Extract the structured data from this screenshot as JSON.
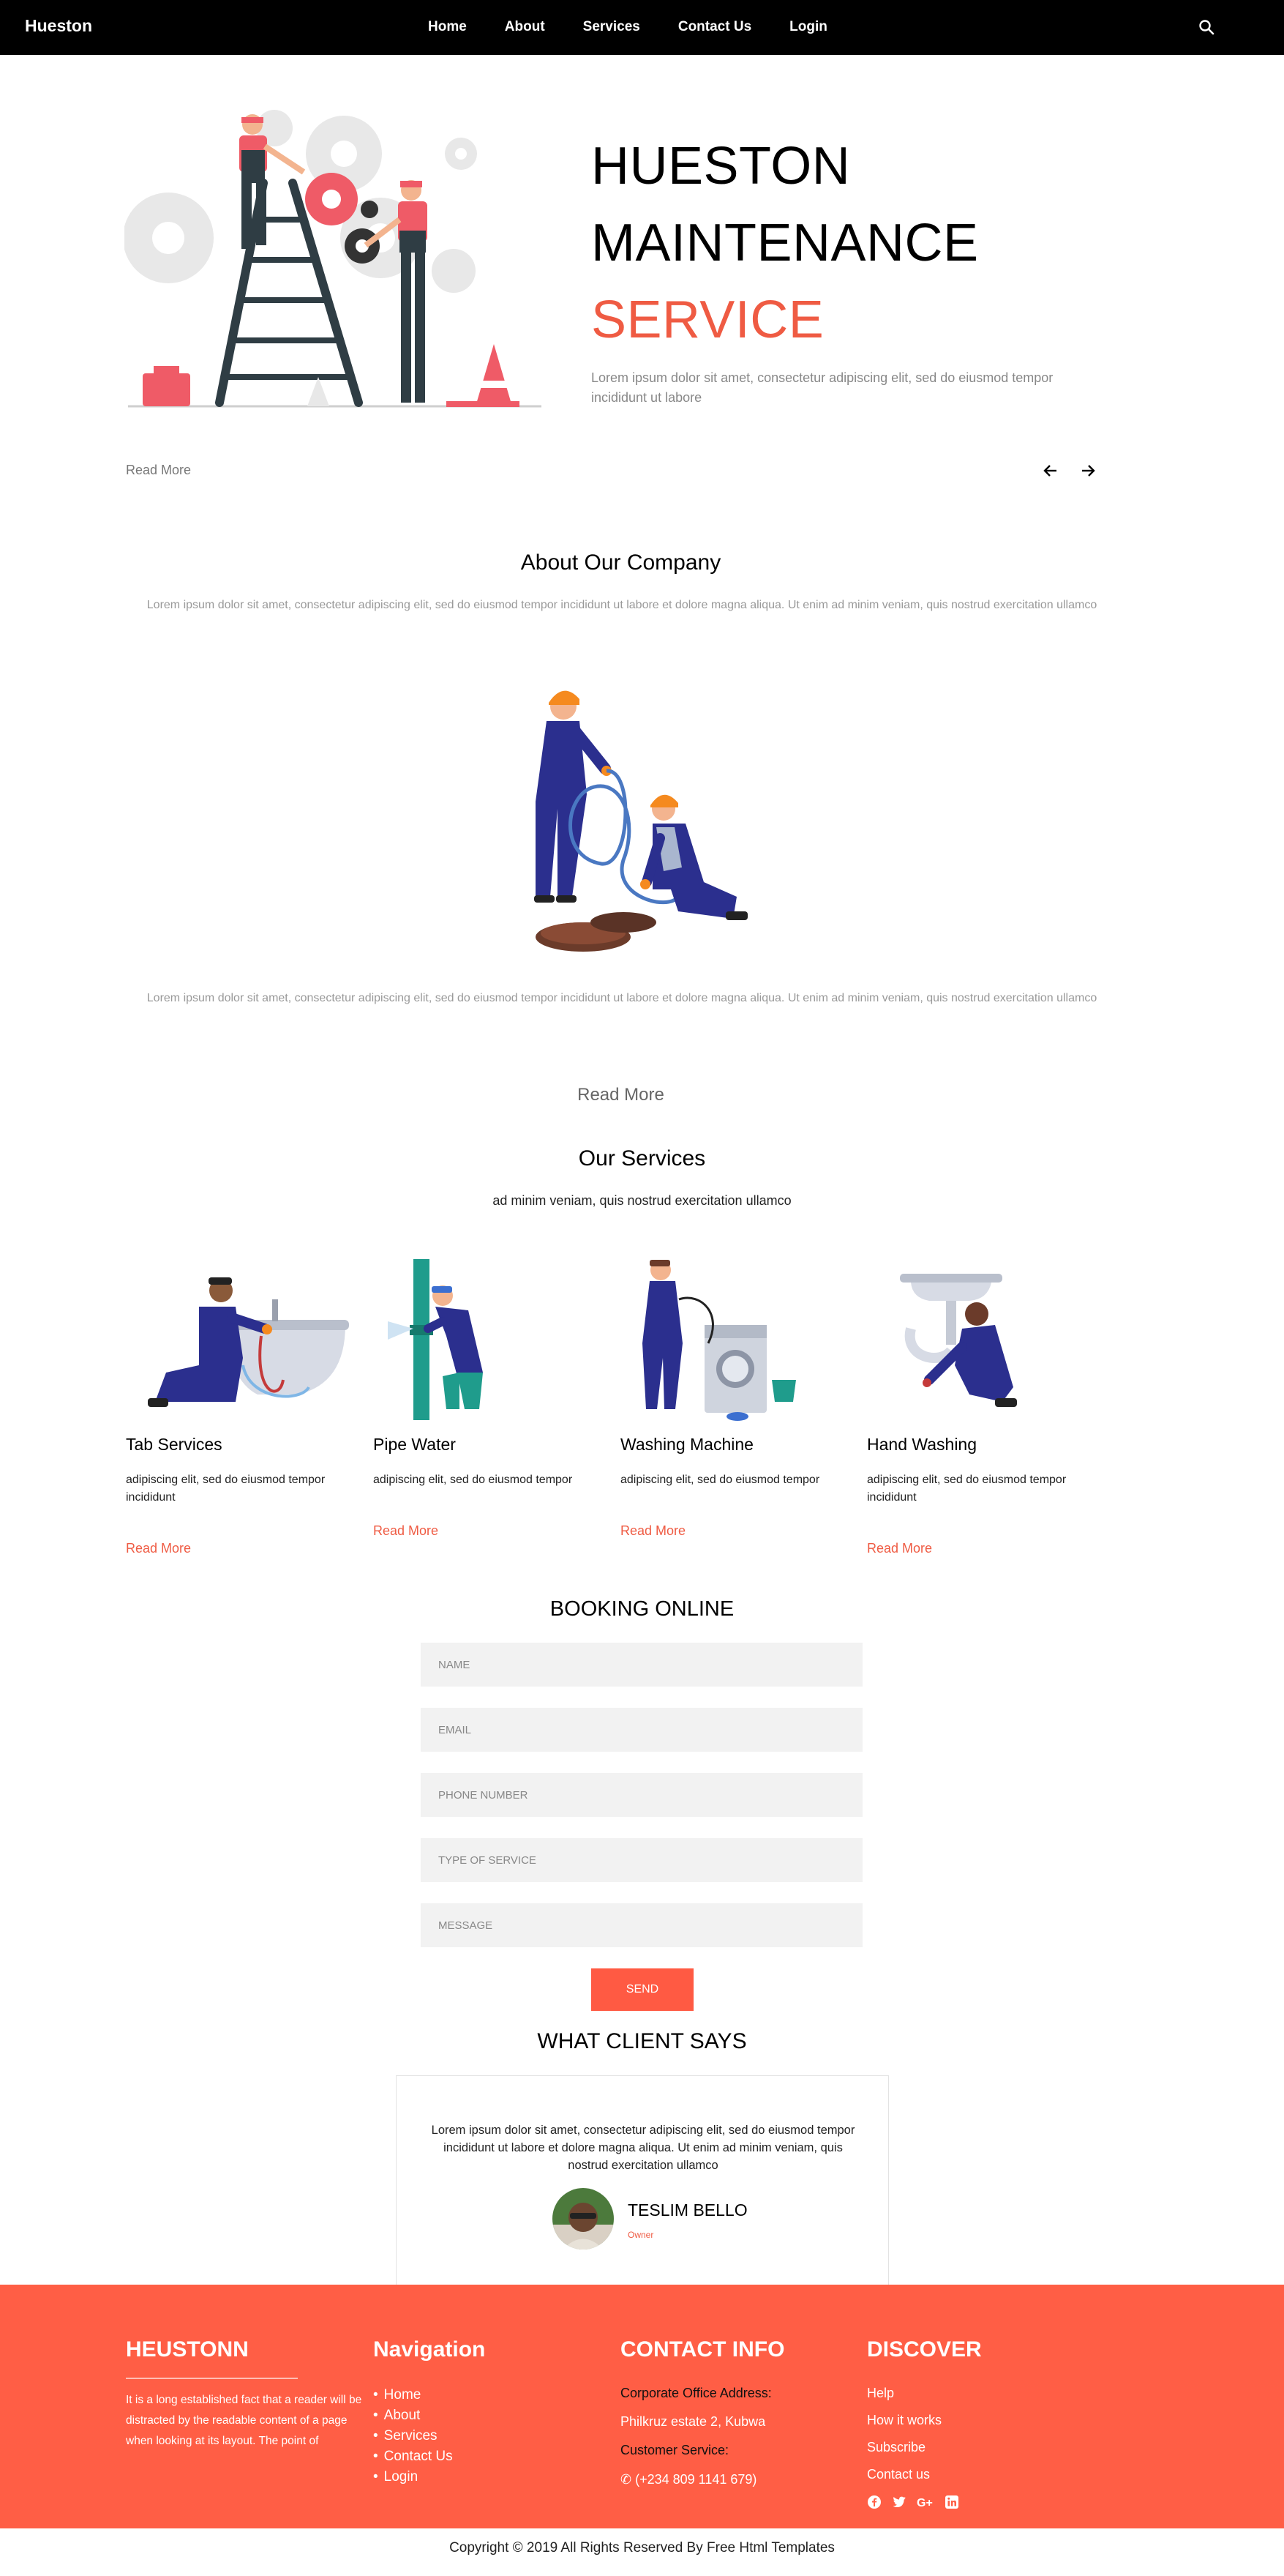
{
  "nav": {
    "brand": "Hueston",
    "links": [
      "Home",
      "About",
      "Services",
      "Contact Us",
      "Login"
    ],
    "search_icon": "search-icon"
  },
  "hero": {
    "line1": "HUESTON",
    "line2": "MAINTENANCE",
    "line3": "SERVICE",
    "description": "Lorem ipsum dolor sit amet, consectetur adipiscing elit, sed do eiusmod tempor incididunt ut labore",
    "read_more": "Read More",
    "accent_color": "#ef5b43"
  },
  "about": {
    "title": "About Our Company",
    "text1": "Lorem ipsum dolor sit amet, consectetur adipiscing elit, sed do eiusmod tempor incididunt ut labore et dolore magna aliqua. Ut enim ad minim veniam, quis nostrud exercitation ullamco",
    "text2": "Lorem ipsum dolor sit amet, consectetur adipiscing elit, sed do eiusmod tempor incididunt ut labore et dolore magna aliqua. Ut enim ad minim veniam, quis nostrud exercitation ullamco",
    "read_more": "Read More"
  },
  "services": {
    "title": "Our Services",
    "subtitle": "ad minim veniam, quis nostrud exercitation ullamco",
    "items": [
      {
        "name": "Tab Services",
        "desc": "adipiscing elit, sed do eiusmod tempor incididunt",
        "read_more": "Read More"
      },
      {
        "name": "Pipe Water",
        "desc": "adipiscing elit, sed do eiusmod tempor",
        "read_more": "Read More"
      },
      {
        "name": "Washing Machine",
        "desc": "adipiscing elit, sed do eiusmod tempor",
        "read_more": "Read More"
      },
      {
        "name": "Hand Washing",
        "desc": "adipiscing elit, sed do eiusmod tempor incididunt",
        "read_more": "Read More"
      }
    ]
  },
  "booking": {
    "title": "BOOKING ONLINE",
    "name_placeholder": "NAME",
    "email_placeholder": "EMAIL",
    "phone_placeholder": "PHONE NUMBER",
    "service_placeholder": "TYPE OF SERVICE",
    "message_placeholder": "MESSAGE",
    "send": "SEND"
  },
  "testimonial": {
    "title": "WHAT CLIENT SAYS",
    "text": "Lorem ipsum dolor sit amet, consectetur adipiscing elit, sed do eiusmod tempor incididunt ut labore et dolore magna aliqua. Ut enim ad minim veniam, quis nostrud exercitation ullamco",
    "name": "TESLIM BELLO",
    "role": "Owner"
  },
  "footer": {
    "about_head": "HEUSTONN",
    "about_text": "It is a long established fact that a reader will be distracted by the readable content of a page when looking at its layout. The point of",
    "nav_head": "Navigation",
    "nav_items": [
      "Home",
      "About",
      "Services",
      "Contact Us",
      "Login"
    ],
    "contact_head": "CONTACT INFO",
    "office_label": "Corporate Office Address:",
    "office_value": "Philkruz estate 2, Kubwa",
    "service_label": "Customer Service:",
    "phone": "(+234 809 1141 679)",
    "discover_head": "DISCOVER",
    "discover_items": [
      "Help",
      "How it works",
      "Subscribe",
      "Contact us"
    ],
    "social_icons": [
      "facebook-icon",
      "twitter-icon",
      "google-plus-icon",
      "linkedin-icon"
    ],
    "bg_color": "#ff5e45"
  },
  "copyright": "Copyright © 2019 All Rights Reserved By Free Html Templates"
}
